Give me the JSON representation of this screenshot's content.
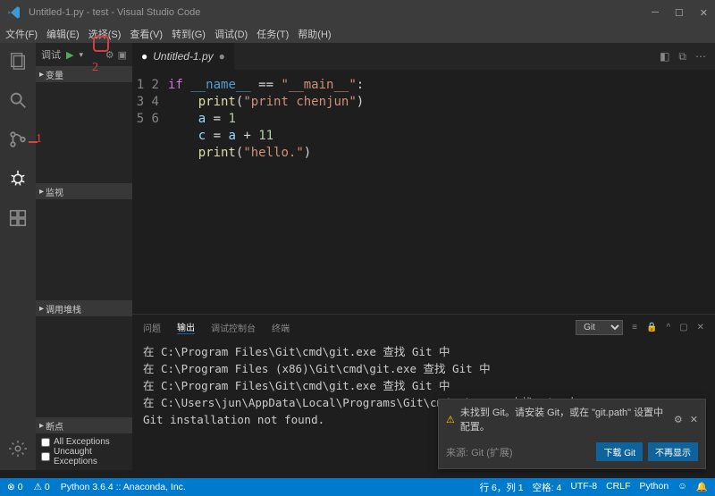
{
  "titlebar": {
    "title": "Untitled-1.py - test - Visual Studio Code"
  },
  "menubar": [
    "文件(F)",
    "编辑(E)",
    "选择(S)",
    "查看(V)",
    "转到(G)",
    "调试(D)",
    "任务(T)",
    "帮助(H)"
  ],
  "annotations": {
    "one": "1",
    "two": "2"
  },
  "sidebar": {
    "header": "调试",
    "sections": {
      "variables": "变量",
      "watch": "监视",
      "callstack": "调用堆栈",
      "breakpoints": "断点"
    },
    "breakpoints": {
      "all": "All Exceptions",
      "uncaught": "Uncaught Exceptions"
    }
  },
  "tabs": {
    "active": "Untitled-1.py"
  },
  "code": {
    "lines": [
      {
        "n": "1",
        "html": "<span class='kw'>if</span> <span class='py'>__name__</span> <span class='op'>==</span> <span class='str'>\"__main__\"</span><span class='op'>:</span>"
      },
      {
        "n": "2",
        "html": "    <span class='fn'>print</span><span class='op'>(</span><span class='str'>\"print chenjun\"</span><span class='op'>)</span>"
      },
      {
        "n": "3",
        "html": "    <span class='nm'>a</span> <span class='op'>=</span> <span class='num'>1</span>"
      },
      {
        "n": "4",
        "html": "    <span class='nm'>c</span> <span class='op'>=</span> <span class='nm'>a</span> <span class='op'>+</span> <span class='num'>11</span>"
      },
      {
        "n": "5",
        "html": "    <span class='fn'>print</span><span class='op'>(</span><span class='str'>\"hello.\"</span><span class='op'>)</span>"
      },
      {
        "n": "6",
        "html": ""
      }
    ]
  },
  "panel": {
    "tabs": {
      "problems": "问题",
      "output": "输出",
      "debugconsole": "调试控制台",
      "terminal": "终端"
    },
    "channel": "Git",
    "body": "在 C:\\Program Files\\Git\\cmd\\git.exe 查找 Git 中\n在 C:\\Program Files (x86)\\Git\\cmd\\git.exe 查找 Git 中\n在 C:\\Program Files\\Git\\cmd\\git.exe 查找 Git 中\n在 C:\\Users\\jun\\AppData\\Local\\Programs\\Git\\cmd\\git.exe 查找 Git 中\nGit installation not found."
  },
  "notification": {
    "text": "未找到 Git。请安装 Git，或在 \"git.path\" 设置中配置。",
    "source": "来源: Git (扩展)",
    "btn1": "下载 Git",
    "btn2": "不再显示"
  },
  "statusbar": {
    "left": {
      "errors": "⊗ 0",
      "warnings": "⚠ 0",
      "python": "Python 3.6.4 :: Anaconda, Inc."
    },
    "right": {
      "cursor": "行 6，列 1",
      "spaces": "空格: 4",
      "encoding": "UTF-8",
      "eol": "CRLF",
      "lang": "Python",
      "feedback": "☺",
      "bell": "🔔"
    }
  }
}
